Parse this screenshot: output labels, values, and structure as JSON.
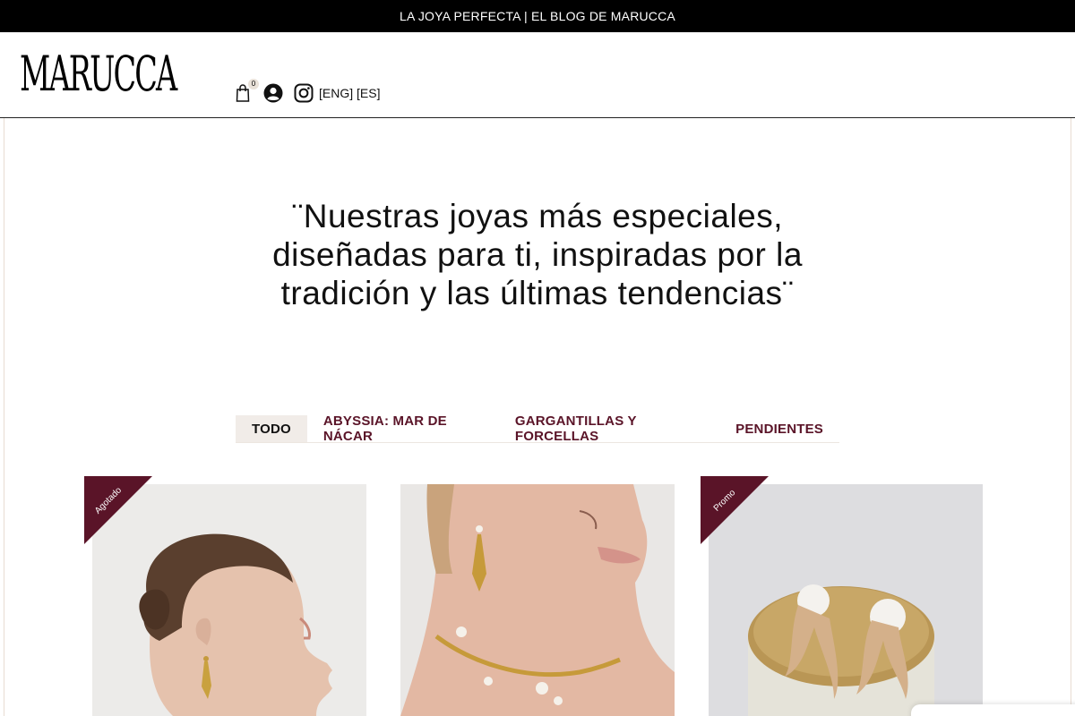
{
  "topbar": {
    "text": "LA JOYA PERFECTA | EL BLOG DE MARUCCA"
  },
  "header": {
    "logo": "MARUCCA",
    "cart_count": "0",
    "lang_en": "[ENG]",
    "lang_es": "[ES]"
  },
  "hero": {
    "quote_line1": "¨Nuestras joyas más especiales,",
    "quote_line2": "diseñadas para ti, inspiradas por la",
    "quote_line3": "tradición y las últimas tendencias¨"
  },
  "tabs": [
    {
      "label": "TODO"
    },
    {
      "label": "ABYSSIA: MAR DE NÁCAR"
    },
    {
      "label": "GARGANTILLAS Y FORCELLAS"
    },
    {
      "label": "PENDIENTES"
    }
  ],
  "products": [
    {
      "ribbon": "Agotado"
    },
    {
      "ribbon": ""
    },
    {
      "ribbon": "Promo"
    }
  ],
  "colors": {
    "topbar_bg": "#000000",
    "accent": "#5a1428",
    "tab_active_bg": "#f1ece8"
  }
}
